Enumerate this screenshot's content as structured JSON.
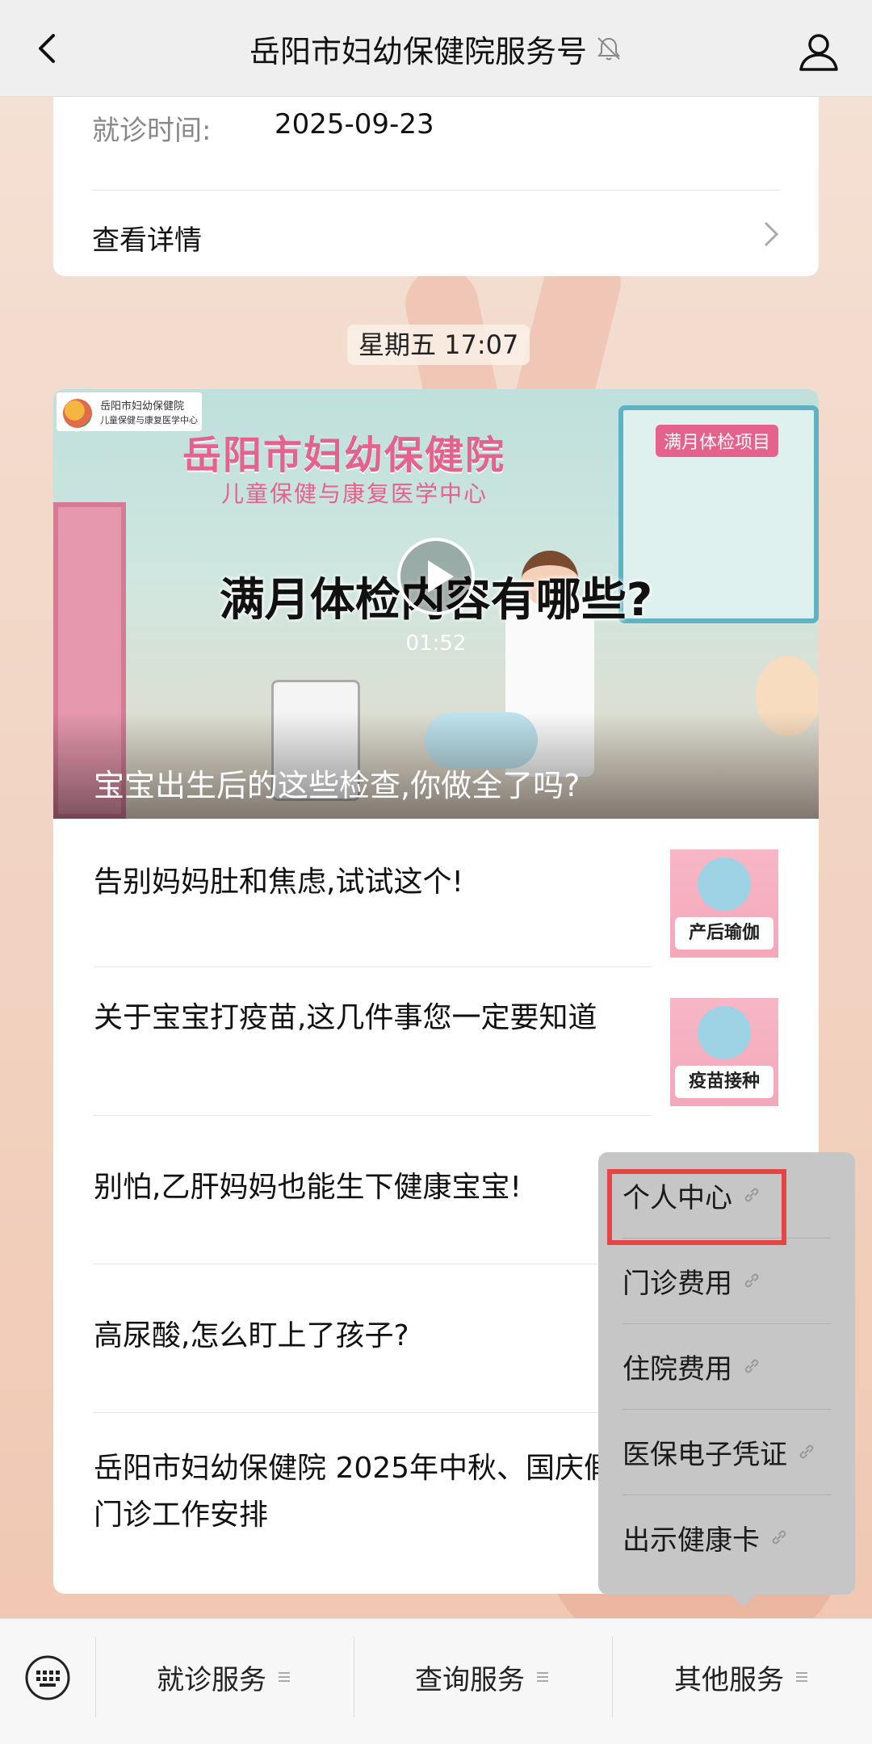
{
  "header": {
    "title": "岳阳市妇幼保健院服务号"
  },
  "appointment_card": {
    "visit_label": "就诊时间:",
    "visit_date": "2025-09-23",
    "detail_link": "查看详情"
  },
  "timestamp": "星期五 17:07",
  "article": {
    "cover": {
      "logo_text_line1": "岳阳市妇幼保健院",
      "logo_text_line2": "儿童保健与康复医学中心",
      "hospital_name": "岳阳市妇幼保健院",
      "department": "儿童保健与康复医学中心",
      "board_title": "满月体检项目",
      "headline": "满月体检内容有哪些?",
      "duration": "01:52",
      "caption": "宝宝出生后的这些检查,你做全了吗?"
    },
    "items": [
      {
        "title": "告别妈妈肚和焦虑,试试这个!",
        "thumb_label": "产后瑜伽"
      },
      {
        "title": "关于宝宝打疫苗,这几件事您一定要知道",
        "thumb_label": "疫苗接种"
      },
      {
        "title": "别怕,乙肝妈妈也能生下健康宝宝!"
      },
      {
        "title": "高尿酸,怎么盯上了孩子?"
      },
      {
        "title": "岳阳市妇幼保健院 2025年中秋、国庆假期门诊工作安排"
      }
    ]
  },
  "popup_menu": {
    "items": [
      "个人中心",
      "门诊费用",
      "住院费用",
      "医保电子凭证",
      "出示健康卡"
    ],
    "highlighted_index": 0
  },
  "bottom_menu": {
    "tabs": [
      "就诊服务",
      "查询服务",
      "其他服务"
    ]
  },
  "colors": {
    "highlight": "#e54545",
    "brand_pink": "#e5628d"
  }
}
